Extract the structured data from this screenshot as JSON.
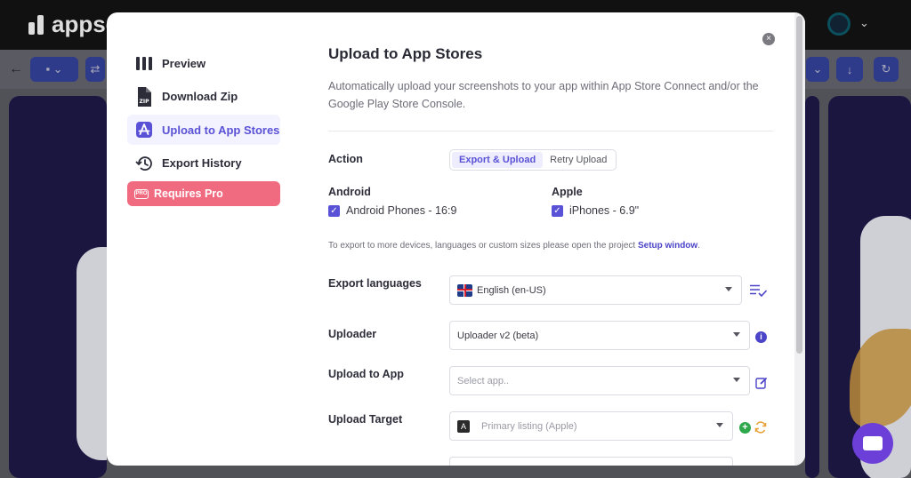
{
  "app": {
    "logo_text": "appsc"
  },
  "modal": {
    "title": "Upload to App Stores",
    "description": "Automatically upload your screenshots to your app within App Store Connect and/or the Google Play Store Console.",
    "close_label": "×"
  },
  "sidebar": {
    "items": [
      {
        "label": "Preview",
        "icon": "columns-icon"
      },
      {
        "label": "Download Zip",
        "icon": "zip-file-icon"
      },
      {
        "label": "Upload to App Stores",
        "icon": "app-store-icon",
        "active": true
      },
      {
        "label": "Export History",
        "icon": "history-icon"
      }
    ],
    "pro_badge": "Requires Pro",
    "pro_icon_text": "PRO"
  },
  "action": {
    "label": "Action",
    "options": [
      "Export & Upload",
      "Retry Upload"
    ],
    "selected": "Export & Upload"
  },
  "android": {
    "heading": "Android",
    "device": "Android Phones - 16:9",
    "checked": true
  },
  "apple": {
    "heading": "Apple",
    "device": "iPhones - 6.9\"",
    "checked": true
  },
  "note": {
    "text": "To export to more devices, languages or custom sizes please open the project ",
    "link": "Setup window",
    "suffix": "."
  },
  "export_languages": {
    "label": "Export languages",
    "value": "English (en-US)"
  },
  "uploader": {
    "label": "Uploader",
    "value": "Uploader v2 (beta)"
  },
  "upload_to_app": {
    "label": "Upload to App",
    "placeholder": "Select app.."
  },
  "upload_target": {
    "label": "Upload Target",
    "placeholder": "Primary listing (Apple)"
  },
  "colors": {
    "accent": "#5a52d6",
    "pro": "#f16b80",
    "success": "#2ea84a",
    "refresh": "#e8a23a"
  }
}
